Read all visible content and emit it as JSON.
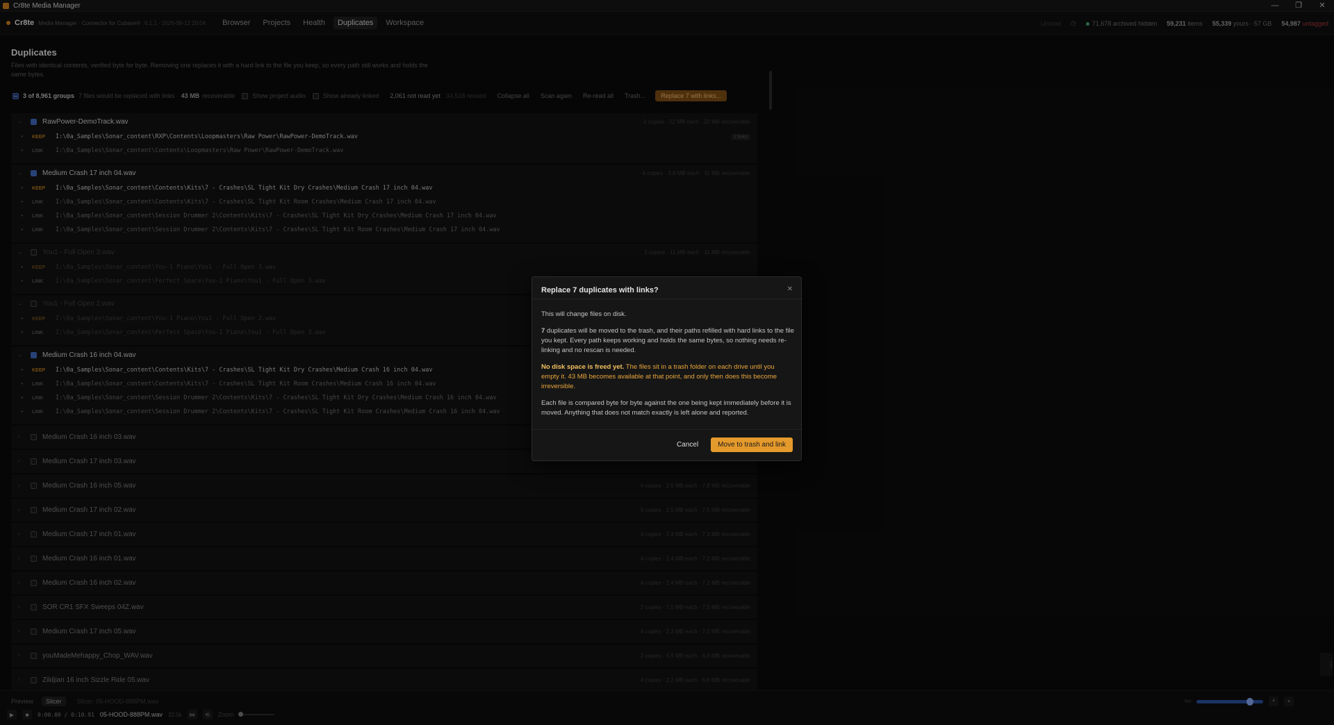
{
  "window": {
    "title": "Cr8te Media Manager",
    "controls": [
      "—",
      "❐",
      "✕"
    ]
  },
  "nav": {
    "brand": "Cr8te",
    "subtitle": "Media Manager · Connector for Cubase®",
    "version": "0.1.1 · 2026-06-12 20:04",
    "tabs": [
      {
        "label": "Browser"
      },
      {
        "label": "Projects"
      },
      {
        "label": "Health"
      },
      {
        "label": "Duplicates",
        "active": true
      },
      {
        "label": "Workspace"
      }
    ],
    "status_left": "Unmod",
    "archived": "71,678 archived hidden",
    "items_count": "59,231",
    "items_label": "items",
    "yours_count": "55,339",
    "yours_label": "yours · 57 GB",
    "untagged_count": "54,987",
    "untagged_label": "untagged"
  },
  "page": {
    "title": "Duplicates",
    "description": "Files with identical contents, verified byte for byte. Removing one replaces it with a hard link to the file you keep, so every path still works and holds the same bytes."
  },
  "toolbar": {
    "groups": "3 of 8,961 groups",
    "summary": "7 files would be replaced with links ·",
    "recoverable": "43 MB",
    "recoverable_suffix": "recoverable",
    "show_project_audio": "Show project audio",
    "show_already_linked": "Show already linked",
    "not_read": "2,061 not read yet",
    "reused": "34,538 reused",
    "collapse_all": "Collapse all",
    "scan_again": "Scan again",
    "reread_all": "Re-read all",
    "trash": "Trash...",
    "replace": "Replace 7 with links..."
  },
  "groups": [
    {
      "name": "RawPower-DemoTrack.wav",
      "meta": "2 copies · 22 MB each · 22 MB recoverable",
      "checked": true,
      "files": [
        {
          "tag": "KEEP",
          "path": "I:\\0a_Samples\\Sonar_content\\RXP\\Contents\\Loopmasters\\Raw Power\\RawPower-DemoTrack.wav",
          "badge": "2 links"
        },
        {
          "tag": "LINK",
          "path": "I:\\0a_Samples\\Sonar_content\\Contents\\Loopmasters\\Raw Power\\RawPower-DemoTrack.wav"
        }
      ]
    },
    {
      "name": "Medium Crash 17 inch 04.wav",
      "meta": "4 copies · 3.8 MB each · 11 MB recoverable",
      "checked": true,
      "files": [
        {
          "tag": "KEEP",
          "path": "I:\\0a_Samples\\Sonar_content\\Contents\\Kits\\7 - Crashes\\SL Tight Kit Dry Crashes\\Medium Crash 17 inch 04.wav"
        },
        {
          "tag": "LINK",
          "path": "I:\\0a_Samples\\Sonar_content\\Contents\\Kits\\7 - Crashes\\SL Tight Kit Room Crashes\\Medium Crash 17 inch 04.wav"
        },
        {
          "tag": "LINK",
          "path": "I:\\0a_Samples\\Sonar_content\\Session Drummer 2\\Contents\\Kits\\7 - Crashes\\SL Tight Kit Dry Crashes\\Medium Crash 17 inch 04.wav"
        },
        {
          "tag": "LINK",
          "path": "I:\\0a_Samples\\Sonar_content\\Session Drummer 2\\Contents\\Kits\\7 - Crashes\\SL Tight Kit Room Crashes\\Medium Crash 17 inch 04.wav"
        }
      ]
    },
    {
      "name": "You1 - Full Open 3.wav",
      "meta": "2 copies · 11 MB each · 11 MB recoverable",
      "checked": false,
      "dim": true,
      "files": [
        {
          "tag": "KEEP",
          "path": "I:\\0a_Samples\\Sonar_content\\You-1 Piano\\You1 - Full Open 3.wav"
        },
        {
          "tag": "LINK",
          "path": "I:\\0a_Samples\\Sonar_content\\Perfect Space\\You-1 Piano\\You1 - Full Open 3.wav"
        }
      ]
    },
    {
      "name": "You1 - Full Open 2.wav",
      "meta": "",
      "checked": false,
      "dim": true,
      "files": [
        {
          "tag": "KEEP",
          "path": "I:\\0a_Samples\\Sonar_content\\You-1 Piano\\You1 - Full Open 2.wav"
        },
        {
          "tag": "LINK",
          "path": "I:\\0a_Samples\\Sonar_content\\Perfect Space\\You-1 Piano\\You1 - Full Open 3.wav"
        }
      ]
    },
    {
      "name": "Medium Crash 16 inch 04.wav",
      "meta": "",
      "checked": true,
      "files": [
        {
          "tag": "KEEP",
          "path": "I:\\0a_Samples\\Sonar_content\\Contents\\Kits\\7 - Crashes\\SL Tight Kit Dry Crashes\\Medium Crash 16 inch 04.wav"
        },
        {
          "tag": "LINK",
          "path": "I:\\0a_Samples\\Sonar_content\\Contents\\Kits\\7 - Crashes\\SL Tight Kit Room Crashes\\Medium Crash 16 inch 04.wav"
        },
        {
          "tag": "LINK",
          "path": "I:\\0a_Samples\\Sonar_content\\Session Drummer 2\\Contents\\Kits\\7 - Crashes\\SL Tight Kit Dry Crashes\\Medium Crash 16 inch 04.wav"
        },
        {
          "tag": "LINK",
          "path": "I:\\0a_Samples\\Sonar_content\\Session Drummer 2\\Contents\\Kits\\7 - Crashes\\SL Tight Kit Room Crashes\\Medium Crash 16 inch 04.wav"
        }
      ]
    }
  ],
  "collapsed_groups": [
    {
      "name": "Medium Crash 16 inch 03.wav",
      "meta": ""
    },
    {
      "name": "Medium Crash 17 inch 03.wav",
      "meta": ""
    },
    {
      "name": "Medium Crash 16 inch 05.wav",
      "meta": "4 copies · 2.6 MB each · 7.8 MB recoverable"
    },
    {
      "name": "Medium Crash 17 inch 02.wav",
      "meta": "4 copies · 2.5 MB each · 7.5 MB recoverable"
    },
    {
      "name": "Medium Crash 17 inch 01.wav",
      "meta": "4 copies · 2.4 MB each · 7.3 MB recoverable"
    },
    {
      "name": "Medium Crash 16 inch 01.wav",
      "meta": "4 copies · 2.4 MB each · 7.2 MB recoverable"
    },
    {
      "name": "Medium Crash 16 inch 02.wav",
      "meta": "4 copies · 2.4 MB each · 7.2 MB recoverable"
    },
    {
      "name": "SOR CR1 SFX Sweeps 04Z.wav",
      "meta": "2 copies · 7.0 MB each · 7.0 MB recoverable"
    },
    {
      "name": "Medium Crash 17 inch 05.wav",
      "meta": "4 copies · 2.3 MB each · 7.0 MB recoverable"
    },
    {
      "name": "youMadeMehappy_Chop_WAV.wav",
      "meta": "2 copies · 6.9 MB each · 6.9 MB recoverable"
    },
    {
      "name": "Zildjian 16 inch Sizzle Ride 05.wav",
      "meta": "4 copies · 2.2 MB each · 6.6 MB recoverable"
    }
  ],
  "bottom": {
    "tab_preview": "Preview",
    "tab_slicer": "Slicer",
    "slicer_file": "Slicer: 05-HOOD-888PM.wav",
    "time": "0:00.00 / 0:10.91",
    "filename": "05-HOOD-888PM.wav",
    "sample_rate": "32.0k",
    "zoom_label": "Zoom",
    "vol_label": "Vol",
    "volume_level": 0.76,
    "side_label": "Info"
  },
  "modal": {
    "title": "Replace 7 duplicates with links?",
    "p1": "This will change files on disk.",
    "p2_count": "7",
    "p2": " duplicates will be moved to the trash, and their paths refilled with hard links to the file you kept. Every path keeps working and holds the same bytes, so nothing needs re-linking and no rescan is needed.",
    "warn_bold": "No disk space is freed yet.",
    "warn": " The files sit in a trash folder on each drive until you empty it. 43 MB becomes available at that point, and only then does this become irreversible.",
    "p4": "Each file is compared byte for byte against the one being kept immediately before it is moved. Anything that does not match exactly is left alone and reported.",
    "cancel": "Cancel",
    "confirm": "Move to trash and link"
  },
  "colors": {
    "accent": "#e59a2c",
    "keep": "#b5781e",
    "checkbox": "#3e66b8",
    "untagged": "#a4343b",
    "status_ok": "#3fa26a"
  }
}
